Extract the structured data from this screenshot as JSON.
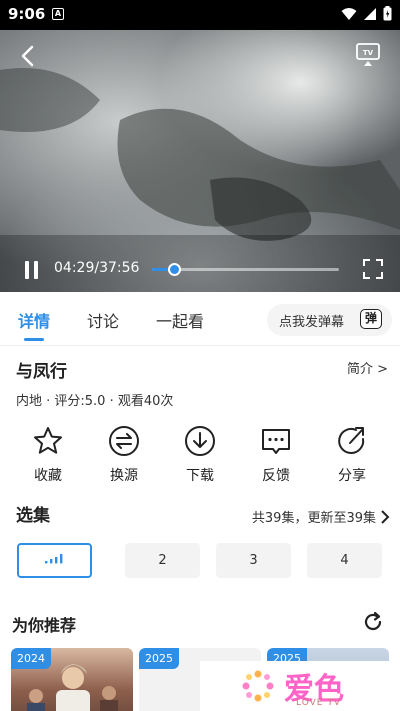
{
  "status_bar": {
    "time": "9:06",
    "notification_letter": "A"
  },
  "player": {
    "time_display": "04:29/37:56",
    "progress": 0.118,
    "accent": "#2f8fe6"
  },
  "tabs": [
    {
      "label": "详情",
      "active": true
    },
    {
      "label": "讨论",
      "active": false
    },
    {
      "label": "一起看",
      "active": false
    }
  ],
  "danmaku": {
    "label": "点我发弹幕",
    "icon_char": "弹"
  },
  "show": {
    "title": "与凤行",
    "intro_link": "简介 >",
    "meta": "内地 · 评分:5.0 · 观看40次"
  },
  "actions": [
    {
      "label": "收藏",
      "icon": "star-icon"
    },
    {
      "label": "换源",
      "icon": "switch-source-icon"
    },
    {
      "label": "下载",
      "icon": "download-icon"
    },
    {
      "label": "反馈",
      "icon": "feedback-icon"
    },
    {
      "label": "分享",
      "icon": "share-icon"
    }
  ],
  "episodes": {
    "title": "选集",
    "summary": "共39集，更新至39集",
    "items": [
      "",
      "2",
      "3",
      "4"
    ]
  },
  "recommend": {
    "title": "为你推荐",
    "cards": [
      {
        "year": "2024"
      },
      {
        "year": "2025"
      },
      {
        "year": "2025"
      }
    ]
  },
  "watermark": {
    "text": "爱色",
    "sub": "LOVE TV"
  }
}
